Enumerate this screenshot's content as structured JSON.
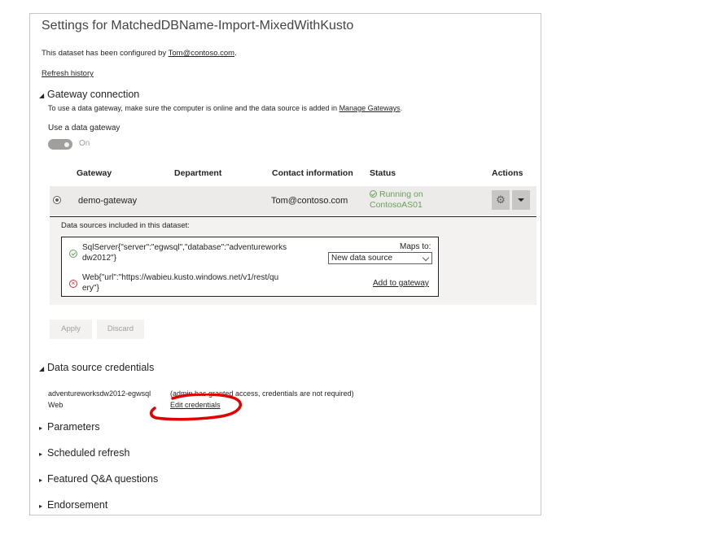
{
  "page": {
    "title": "Settings for MatchedDBName-Import-MixedWithKusto",
    "configured_prefix": "This dataset has been configured by ",
    "configured_user": "Tom@contoso.com",
    "configured_suffix": ".",
    "refresh_history": "Refresh history"
  },
  "gateway_connection": {
    "heading": "Gateway connection",
    "description_prefix": "To use a data gateway, make sure the computer is online and the data source is added in ",
    "manage_gateways": "Manage Gateways",
    "description_suffix": ".",
    "use_gateway_label": "Use a data gateway",
    "toggle_state": "On",
    "table": {
      "headers": [
        "Gateway",
        "Department",
        "Contact information",
        "Status",
        "Actions"
      ],
      "row": {
        "gateway": "demo-gateway",
        "department": "",
        "contact": "Tom@contoso.com",
        "status_line1": "Running on",
        "status_line2": "ContosoAS01"
      }
    },
    "data_sources": {
      "heading": "Data sources included in this dataset:",
      "maps_to_label": "Maps to:",
      "items": [
        {
          "line1": "SqlServer{\"server\":\"egwsql\",\"database\":\"adventureworks",
          "line2": "dw2012\"}",
          "status": "ok",
          "mapping": "New data source"
        },
        {
          "line1": "Web{\"url\":\"https://wabieu.kusto.windows.net/v1/rest/qu",
          "line2": "ery\"}",
          "status": "error",
          "action": "Add to gateway"
        }
      ]
    },
    "apply": "Apply",
    "discard": "Discard"
  },
  "data_source_credentials": {
    "heading": "Data source credentials",
    "items": [
      {
        "name": "adventureworksdw2012-egwsql",
        "note": "(admin has granted access, credentials are not required)"
      },
      {
        "name": "Web",
        "action": "Edit credentials"
      }
    ]
  },
  "sections": [
    {
      "label": "Parameters"
    },
    {
      "label": "Scheduled refresh"
    },
    {
      "label": "Featured Q&A questions"
    },
    {
      "label": "Endorsement"
    }
  ],
  "colors": {
    "ok": "#6a9e5f",
    "error": "#d13438",
    "annotation": "#e00000",
    "row_highlight": "#edebe9",
    "panel": "#f3f2f1"
  }
}
